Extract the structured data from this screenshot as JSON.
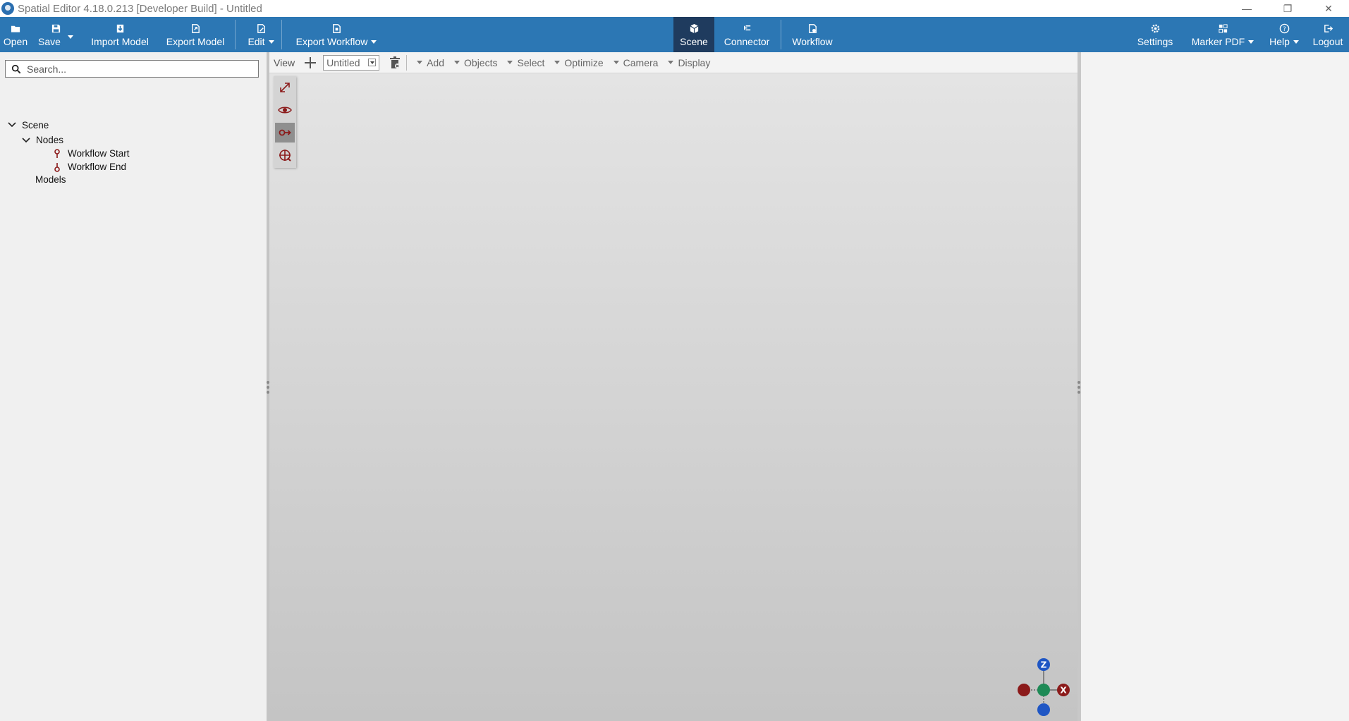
{
  "window": {
    "title": "Spatial Editor 4.18.0.213 [Developer Build] - Untitled",
    "minimize_glyph": "—",
    "restore_glyph": "❐",
    "close_glyph": "✕"
  },
  "ribbon": {
    "open": "Open",
    "save": "Save",
    "import_model": "Import Model",
    "export_model": "Export Model",
    "edit": "Edit",
    "export_workflow": "Export Workflow",
    "scene": "Scene",
    "connector": "Connector",
    "workflow": "Workflow",
    "settings": "Settings",
    "marker_pdf": "Marker PDF",
    "help": "Help",
    "logout": "Logout",
    "active_tab": "Scene",
    "color": "#2c77b4",
    "active_color": "#1f3b5e"
  },
  "tree": {
    "search_placeholder": "Search...",
    "scene": "Scene",
    "nodes": "Nodes",
    "workflow_start": "Workflow Start",
    "workflow_end": "Workflow End",
    "models": "Models"
  },
  "viewport_toolbar": {
    "view": "View",
    "view_select": "Untitled",
    "add": "Add",
    "objects": "Objects",
    "select": "Select",
    "optimize": "Optimize",
    "camera": "Camera",
    "display": "Display"
  },
  "gizmo": {
    "z": "Z",
    "x": "X"
  }
}
